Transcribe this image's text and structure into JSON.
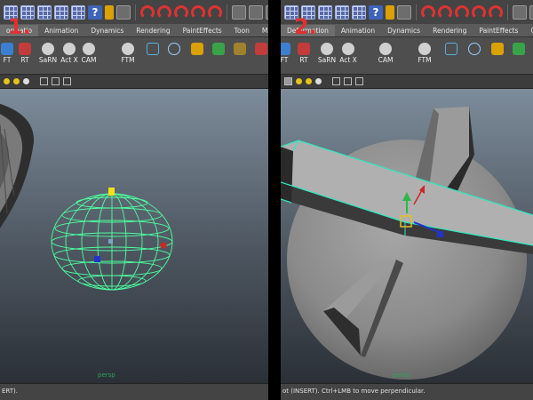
{
  "left": {
    "step": "1.",
    "tabs": [
      "ormatio",
      "Animation",
      "Dynamics",
      "Rendering",
      "PaintEffects",
      "Toon",
      "Muscle"
    ],
    "active_tab": 0,
    "shelf": [
      "FT",
      "RT",
      "SaRN",
      "Act X",
      "CAM",
      "FTM"
    ],
    "viewport_label": "persp",
    "help": "ERT)."
  },
  "right": {
    "step": "2.",
    "tabs": [
      "Deformation",
      "Animation",
      "Dynamics",
      "Rendering",
      "PaintEffects",
      "Cam"
    ],
    "active_tab": 0,
    "shelf": [
      "FT",
      "RT",
      "SaRN",
      "Act X",
      "CAM",
      "FTM"
    ],
    "viewport_label": "persp",
    "help": "ot (INSERT). Ctrl+LMB to move perpendicular."
  },
  "colors": {
    "wireframe": "#4dff9f",
    "selection_outline": "#2ee8c0",
    "step_label": "#e03131",
    "viewport_top": "#7d8c9b",
    "viewport_bottom": "#2b3037"
  },
  "icons": [
    "grid-icon",
    "help-icon",
    "magnet-icon",
    "snap-icon",
    "render-icon"
  ]
}
